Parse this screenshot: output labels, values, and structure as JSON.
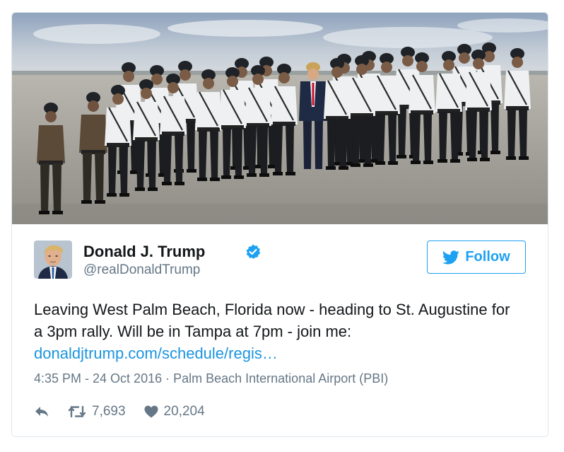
{
  "tweet": {
    "author": {
      "name": "Donald J. Trump",
      "handle": "@realDonaldTrump",
      "verified": true
    },
    "follow_label": "Follow",
    "text": "Leaving West Palm Beach, Florida now - heading to St. Augustine for a 3pm rally. Will be in Tampa at 7pm - join me:",
    "link": "donaldjtrump.com/schedule/regis…",
    "meta": "4:35 PM - 24 Oct 2016 · Palm Beach International Airport (PBI)",
    "retweets": "7,693",
    "likes": "20,204"
  },
  "icons": [
    "verified-icon",
    "bird-icon",
    "reply-icon",
    "retweet-icon",
    "heart-icon"
  ],
  "colors": {
    "accent": "#1da1f2",
    "link": "#1b95e0",
    "text": "#14171a",
    "muted": "#657786",
    "border": "#e1e8ed"
  }
}
